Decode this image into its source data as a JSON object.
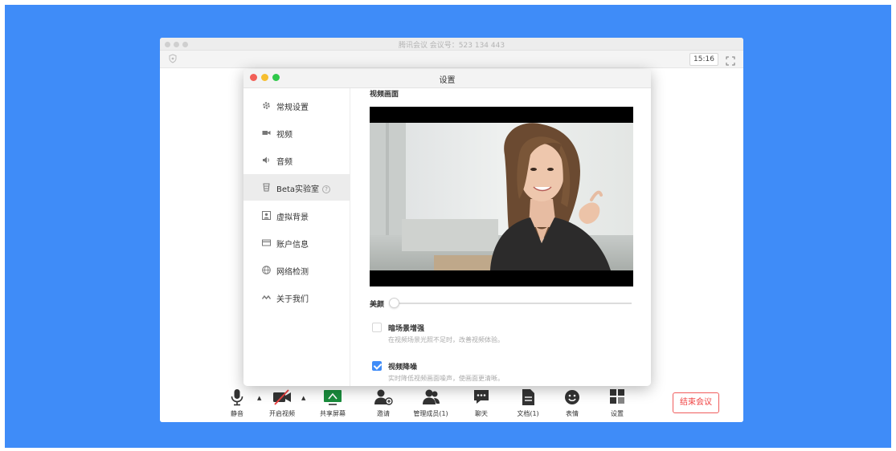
{
  "window": {
    "title": "腾讯会议 会议号：523 134 443",
    "timer": "15:16"
  },
  "toolbar": {
    "mute": "静音",
    "start_video": "开启视频",
    "share_screen": "共享屏幕",
    "invite": "邀请",
    "manage_members": "管理成员(1)",
    "chat": "聊天",
    "docs": "文档(1)",
    "emoji": "表情",
    "settings": "设置",
    "end_meeting": "结束会议"
  },
  "dialog": {
    "title": "设置",
    "sidebar": {
      "items": [
        {
          "label": "常规设置",
          "icon": "gear-icon"
        },
        {
          "label": "视频",
          "icon": "camera-icon"
        },
        {
          "label": "音频",
          "icon": "speaker-icon"
        },
        {
          "label": "Beta实验室",
          "icon": "beaker-icon"
        },
        {
          "label": "虚拟背景",
          "icon": "portrait-icon"
        },
        {
          "label": "账户信息",
          "icon": "card-icon"
        },
        {
          "label": "网络检测",
          "icon": "globe-icon"
        },
        {
          "label": "关于我们",
          "icon": "logo-icon"
        }
      ],
      "active_index": 3
    },
    "content": {
      "section_label": "视频画面",
      "beauty_label": "美颜",
      "beauty_level": 0,
      "low_light": {
        "title": "暗场景增强",
        "desc": "在视频场景光照不足时，改善视频体验。",
        "checked": false
      },
      "denoise": {
        "title": "视频降噪",
        "desc": "实时降低视频画面噪声，使画面更清晰。",
        "checked": true
      }
    }
  },
  "colors": {
    "accent": "#3f8cf8",
    "end_button": "#f04040",
    "traffic_red": "#f25f57",
    "traffic_yellow": "#f6be2f",
    "traffic_green": "#2fc84a"
  }
}
